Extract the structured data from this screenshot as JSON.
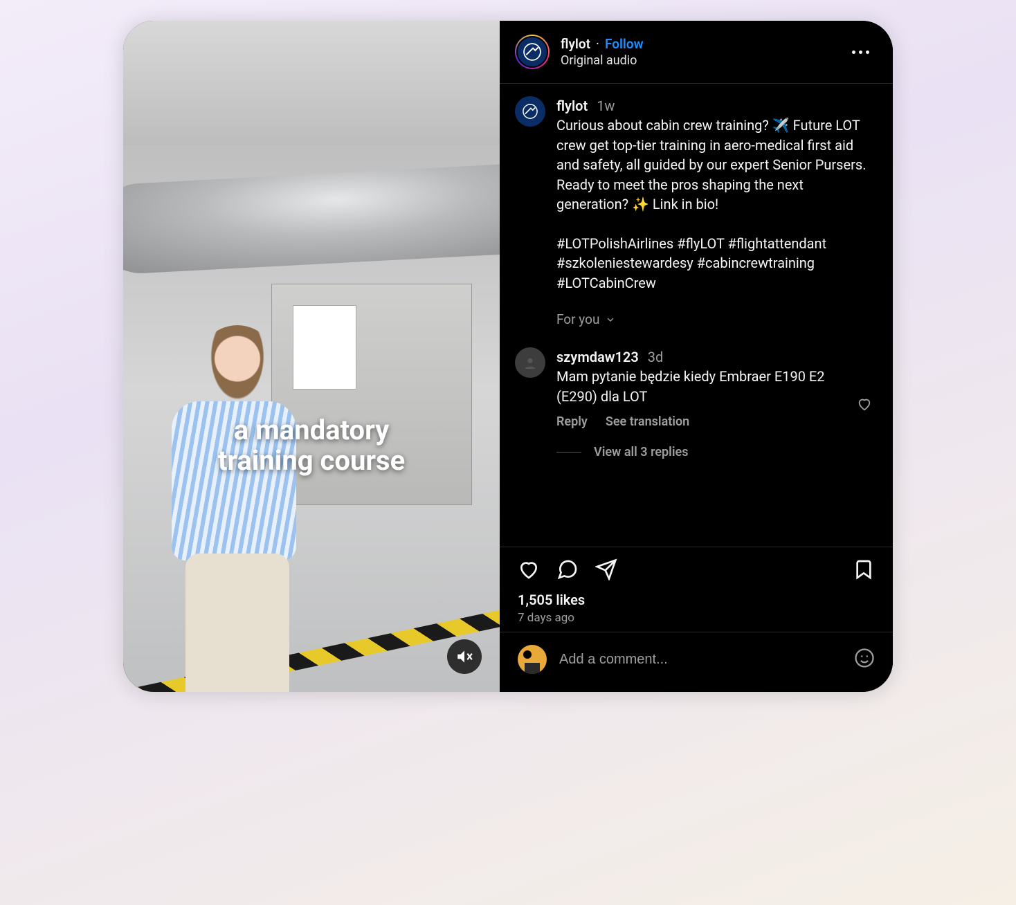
{
  "media": {
    "caption_overlay": "a mandatory\ntraining course"
  },
  "header": {
    "username": "flylot",
    "separator": "·",
    "follow_label": "Follow",
    "audio_label": "Original audio"
  },
  "post_caption": {
    "username": "flylot",
    "timestamp": "1w",
    "body": "Curious about cabin crew training? ✈️ Future LOT crew get top-tier training in aero-medical first aid and safety, all guided by our expert Senior Pursers. Ready to meet the pros shaping the next generation? ✨ Link in bio!",
    "hashtags": "#LOTPolishAirlines #flyLOT #flightattendant #szkoleniestewardesy #cabincrewtraining #LOTCabinCrew",
    "for_you_label": "For you"
  },
  "comments": [
    {
      "username": "szymdaw123",
      "timestamp": "3d",
      "body": "Mam pytanie będzie kiedy Embraer E190 E2 (E290) dla LOT",
      "reply_label": "Reply",
      "translate_label": "See translation",
      "view_replies_label": "View all 3 replies"
    }
  ],
  "actions": {
    "likes_label": "1,505 likes",
    "age_label": "7 days ago"
  },
  "composer": {
    "placeholder": "Add a comment..."
  }
}
